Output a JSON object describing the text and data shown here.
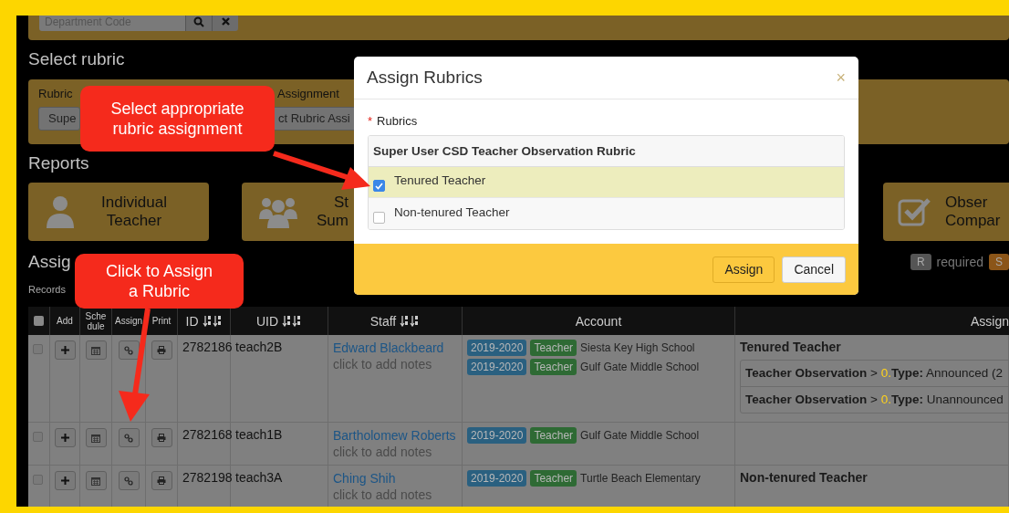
{
  "top_panel": {
    "search": {
      "placeholder": "Department Code"
    }
  },
  "select_rubric": {
    "heading": "Select rubric",
    "labels": [
      "Rubric",
      "Assignment"
    ],
    "selects": [
      "Supe",
      "ct Rubric Assi"
    ]
  },
  "reports": {
    "heading": "Reports",
    "cards": [
      {
        "kind": "person",
        "lines": [
          "Individual",
          "Teacher"
        ]
      },
      {
        "kind": "group",
        "lines": [
          "St",
          "Sum"
        ]
      },
      {
        "kind": "check",
        "lines": [
          "Obser",
          "Compar"
        ]
      }
    ]
  },
  "assignments": {
    "heading": "Assig",
    "records_label": "Records",
    "legend": [
      {
        "badge": "R",
        "label": "required",
        "color": "#555555"
      },
      {
        "badge": "S",
        "color": "#8b5518"
      }
    ]
  },
  "table": {
    "columns": [
      {
        "kind": "checkbox",
        "checked": false
      },
      {
        "kind": "plain",
        "label": "Add"
      },
      {
        "kind": "plain",
        "label": "Schedule"
      },
      {
        "kind": "plain",
        "label": "Assign"
      },
      {
        "kind": "plain",
        "label": "Print"
      },
      {
        "kind": "sortable",
        "label": "ID"
      },
      {
        "kind": "sortable",
        "label": "UID"
      },
      {
        "kind": "sortable",
        "label": "Staff"
      },
      {
        "kind": "plain",
        "label": "Account"
      },
      {
        "kind": "plain",
        "label": "Assign"
      }
    ],
    "rows": [
      {
        "checked": false,
        "id": "2782186",
        "uid": "teach2B",
        "staff": "Edward Blackbeard",
        "notes": "click to add notes",
        "accounts": [
          {
            "year": "2019-2020",
            "role": "Teacher",
            "school": "Siesta Key High School"
          },
          {
            "year": "2019-2020",
            "role": "Teacher",
            "school": "Gulf Gate Middle School"
          }
        ],
        "assignment": {
          "title": "Tenured Teacher",
          "items": [
            {
              "category": "Teacher Observation",
              "separator": ">",
              "number": "0.",
              "field": "Type:",
              "value": "Announced (2"
            },
            {
              "category": "Teacher Observation",
              "separator": ">",
              "number": "0.",
              "field": "Type:",
              "value": "Unannounced"
            }
          ]
        }
      },
      {
        "checked": false,
        "id": "2782168",
        "uid": "teach1B",
        "staff": "Bartholomew Roberts",
        "notes": "click to add notes",
        "accounts": [
          {
            "year": "2019-2020",
            "role": "Teacher",
            "school": "Gulf Gate Middle School"
          }
        ]
      },
      {
        "checked": false,
        "id": "2782198",
        "uid": "teach3A",
        "staff": "Ching Shih",
        "notes": "click to add notes",
        "accounts": [
          {
            "year": "2019-2020",
            "role": "Teacher",
            "school": "Turtle Beach Elementary"
          }
        ],
        "assignment": {
          "title": "Non-tenured Teacher"
        }
      }
    ]
  },
  "modal": {
    "title": "Assign Rubrics",
    "close": "×",
    "required_mark": "*",
    "field_label": "Rubrics",
    "group": "Super User CSD Teacher Observation Rubric",
    "options": [
      {
        "label": "Tenured Teacher",
        "checked": true
      },
      {
        "label": "Non-tenured Teacher",
        "checked": false
      }
    ],
    "buttons": [
      {
        "label": "Assign",
        "kind": "primary"
      },
      {
        "label": "Cancel",
        "kind": "default"
      }
    ]
  },
  "callouts": [
    {
      "text": "Select appropriate\nrubric assignment",
      "kind": "upper"
    },
    {
      "text": "Click to Assign\na Rubric",
      "kind": "lower"
    }
  ]
}
